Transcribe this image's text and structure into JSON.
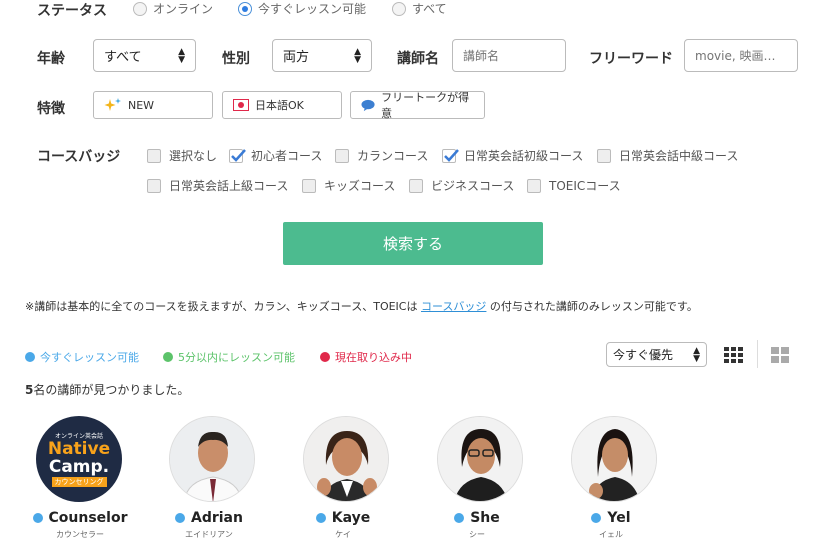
{
  "status": {
    "label": "ステータス",
    "options": [
      {
        "label": "オンライン",
        "selected": false
      },
      {
        "label": "今すぐレッスン可能",
        "selected": true
      },
      {
        "label": "すべて",
        "selected": false
      }
    ]
  },
  "filters": {
    "age_label": "年齢",
    "age_value": "すべて",
    "gender_label": "性別",
    "gender_value": "両方",
    "teacher_label": "講師名",
    "teacher_placeholder": "講師名",
    "freeword_label": "フリーワード",
    "freeword_placeholder": "movie, 映画…"
  },
  "features": {
    "label": "特徴",
    "items": [
      {
        "label": "NEW",
        "icon": "sparkle-icon"
      },
      {
        "label": "日本語OK",
        "icon": "japan-flag-icon"
      },
      {
        "label": "フリートークが得意",
        "icon": "speech-bubble-icon"
      }
    ]
  },
  "course_badges": {
    "label": "コースバッジ",
    "items": [
      {
        "label": "選択なし",
        "checked": false
      },
      {
        "label": "初心者コース",
        "checked": true
      },
      {
        "label": "カランコース",
        "checked": false
      },
      {
        "label": "日常英会話初級コース",
        "checked": true
      },
      {
        "label": "日常英会話中級コース",
        "checked": false
      },
      {
        "label": "日常英会話上級コース",
        "checked": false
      },
      {
        "label": "キッズコース",
        "checked": false
      },
      {
        "label": "ビジネスコース",
        "checked": false
      },
      {
        "label": "TOEICコース",
        "checked": false
      }
    ]
  },
  "search_button": "検索する",
  "note": {
    "prefix": "※講師は基本的に全てのコースを扱えますが、カラン、キッズコース、TOEICは ",
    "link": "コースバッジ",
    "suffix": " の付与された講師のみレッスン可能です。"
  },
  "legend": [
    {
      "label": "今すぐレッスン可能",
      "color": "#4aa8e8"
    },
    {
      "label": "5分以内にレッスン可能",
      "color": "#5cc36a"
    },
    {
      "label": "現在取り込み中",
      "color": "#e0284a"
    }
  ],
  "sort": {
    "value": "今すぐ優先"
  },
  "result_count": {
    "number": "5",
    "text": "名の講師が見つかりました。"
  },
  "teachers": [
    {
      "name": "Counselor",
      "kana": "カウンセラー",
      "logo_top": "オンライン英会話",
      "logo_main1": "Native",
      "logo_main2": "Camp.",
      "logo_sub": "カウンセリング"
    },
    {
      "name": "Adrian",
      "kana": "エイドリアン"
    },
    {
      "name": "Kaye",
      "kana": "ケイ"
    },
    {
      "name": "She",
      "kana": "シー"
    },
    {
      "name": "Yel",
      "kana": "イェル"
    }
  ],
  "colors": {
    "accent": "#4cbb8f",
    "link": "#2f8fd6",
    "status_now": "#4aa8e8"
  }
}
